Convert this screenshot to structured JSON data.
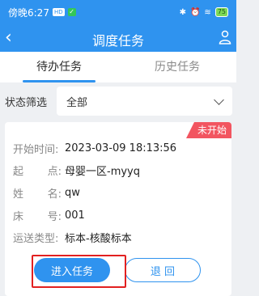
{
  "status_bar": {
    "time": "傍晚6:27",
    "chip": "HD",
    "battery": "75"
  },
  "nav": {
    "title": "调度任务"
  },
  "tabs": [
    {
      "label": "待办任务",
      "active": true
    },
    {
      "label": "历史任务",
      "active": false
    }
  ],
  "filter": {
    "label": "状态筛选",
    "selected": "全部"
  },
  "card": {
    "badge": "未开始",
    "start_time_label": "开始时间:",
    "start_time_value": "2023-03-09 18:13:56",
    "origin_label_1": "起",
    "origin_label_2": "点:",
    "origin_value": "母婴一区-myyq",
    "name_label_1": "姓",
    "name_label_2": "名:",
    "name_value": "qw",
    "bed_label_1": "床",
    "bed_label_2": "号:",
    "bed_value": "001",
    "transport_label": "运送类型:",
    "transport_value": "标本-核酸标本",
    "enter_button": "进入任务",
    "back_button": "退  回"
  },
  "colors": {
    "primary": "#2f93ef",
    "badge": "#f25560",
    "highlight": "#e22020"
  }
}
